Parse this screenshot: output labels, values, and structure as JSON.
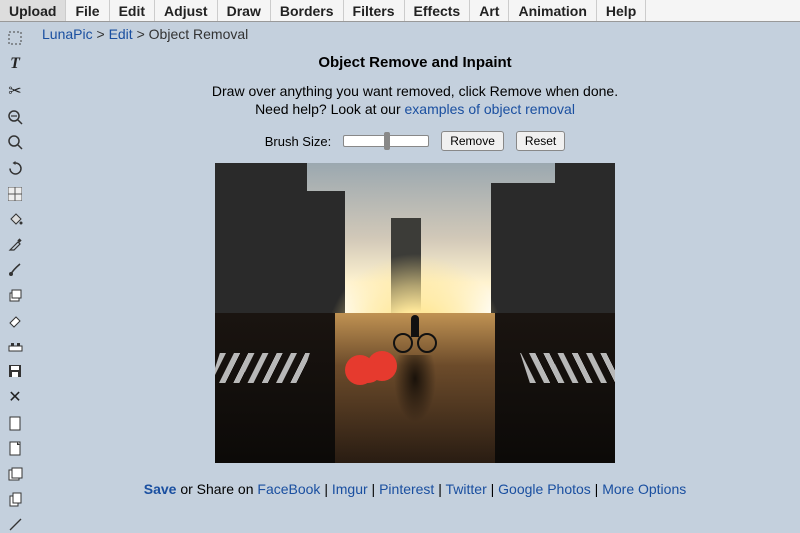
{
  "topbar": {
    "items": [
      {
        "label": "Upload"
      },
      {
        "label": "File"
      },
      {
        "label": "Edit"
      },
      {
        "label": "Adjust"
      },
      {
        "label": "Draw"
      },
      {
        "label": "Borders"
      },
      {
        "label": "Filters"
      },
      {
        "label": "Effects"
      },
      {
        "label": "Art"
      },
      {
        "label": "Animation"
      },
      {
        "label": "Help"
      }
    ]
  },
  "breadcrumb": {
    "root": "LunaPic",
    "sep": ">",
    "section": "Edit",
    "page": "Object Removal"
  },
  "page": {
    "title": "Object Remove and Inpaint",
    "instruction": "Draw over anything you want removed, click Remove when done.",
    "help_prefix": "Need help? Look at our ",
    "help_link": "examples of object removal"
  },
  "controls": {
    "brush_label": "Brush Size:",
    "remove": "Remove",
    "reset": "Reset"
  },
  "footer": {
    "save": "Save",
    "or_share": " or Share on ",
    "links": [
      "FaceBook",
      "Imgur",
      "Pinterest",
      "Twitter",
      "Google Photos",
      "More Options"
    ],
    "sep": " | "
  },
  "tools": [
    "select",
    "text",
    "cut",
    "zoom-out",
    "zoom-in",
    "rotate",
    "grid",
    "fill",
    "picker",
    "brush",
    "layers",
    "erase",
    "adjust",
    "save",
    "crop",
    "page",
    "sheet",
    "stack",
    "copy",
    "line"
  ]
}
